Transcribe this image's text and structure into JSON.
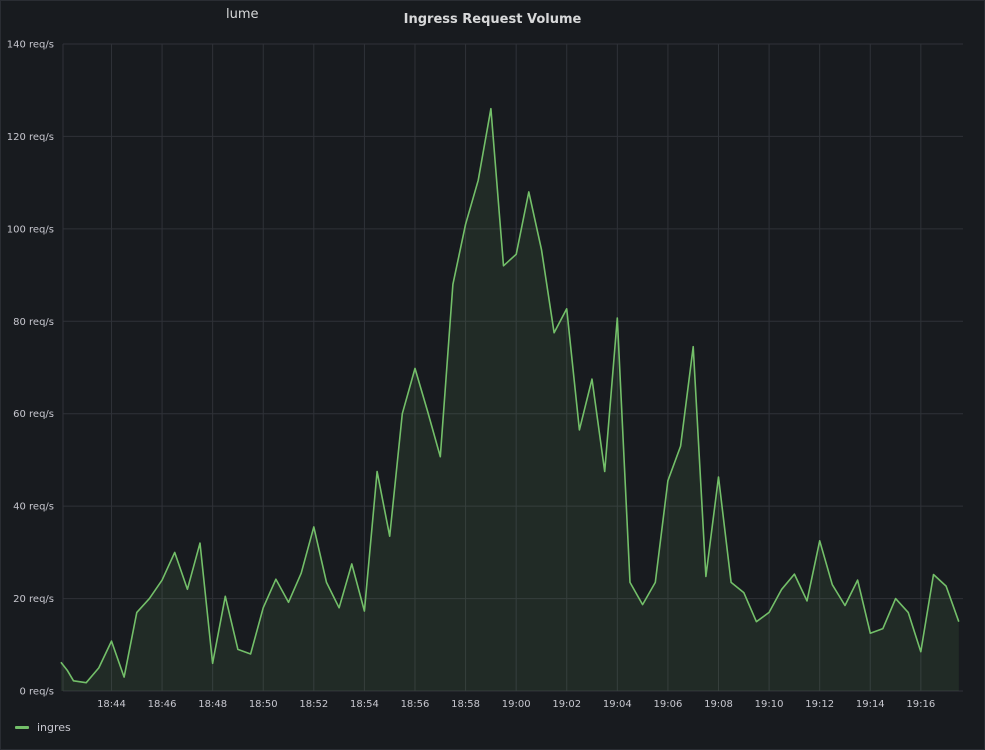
{
  "panel": {
    "ghost_title": "lume",
    "title": "Ingress Request Volume"
  },
  "chart_data": {
    "type": "area",
    "title": "Ingress Request Volume",
    "unit": "req/s",
    "ylim": [
      0,
      140
    ],
    "y_ticks": [
      "0 req/s",
      "20 req/s",
      "40 req/s",
      "60 req/s",
      "80 req/s",
      "100 req/s",
      "120 req/s",
      "140 req/s"
    ],
    "x_ticks": [
      "18:44",
      "18:46",
      "18:48",
      "18:50",
      "18:52",
      "18:54",
      "18:56",
      "18:58",
      "19:00",
      "19:02",
      "19:04",
      "19:06",
      "19:08",
      "19:10",
      "19:12",
      "19:14",
      "19:16"
    ],
    "xlim": [
      "18:42:05",
      "19:17:40"
    ],
    "grid": true,
    "legend_position": "bottom-left",
    "series": [
      {
        "name": "ingres",
        "color": "#73bf69",
        "points": [
          [
            "18:42:00",
            6.2
          ],
          [
            "18:42:15",
            4.5
          ],
          [
            "18:42:30",
            2.2
          ],
          [
            "18:43:00",
            1.8
          ],
          [
            "18:43:30",
            5.0
          ],
          [
            "18:44:00",
            10.8
          ],
          [
            "18:44:30",
            3.0
          ],
          [
            "18:45:00",
            17.0
          ],
          [
            "18:45:30",
            20.0
          ],
          [
            "18:46:00",
            24.0
          ],
          [
            "18:46:30",
            30.0
          ],
          [
            "18:47:00",
            22.0
          ],
          [
            "18:47:30",
            32.0
          ],
          [
            "18:48:00",
            6.0
          ],
          [
            "18:48:30",
            20.5
          ],
          [
            "18:49:00",
            9.0
          ],
          [
            "18:49:30",
            8.0
          ],
          [
            "18:50:00",
            18.0
          ],
          [
            "18:50:30",
            24.2
          ],
          [
            "18:51:00",
            19.2
          ],
          [
            "18:51:30",
            25.5
          ],
          [
            "18:52:00",
            35.5
          ],
          [
            "18:52:30",
            23.5
          ],
          [
            "18:53:00",
            18.0
          ],
          [
            "18:53:30",
            27.5
          ],
          [
            "18:54:00",
            17.3
          ],
          [
            "18:54:30",
            47.5
          ],
          [
            "18:55:00",
            33.5
          ],
          [
            "18:55:30",
            60.0
          ],
          [
            "18:56:00",
            69.8
          ],
          [
            "18:56:30",
            60.5
          ],
          [
            "18:57:00",
            50.7
          ],
          [
            "18:57:30",
            88.0
          ],
          [
            "18:58:00",
            101.0
          ],
          [
            "18:58:30",
            110.5
          ],
          [
            "18:59:00",
            126.0
          ],
          [
            "18:59:30",
            92.0
          ],
          [
            "19:00:00",
            94.5
          ],
          [
            "19:00:30",
            108.0
          ],
          [
            "19:01:00",
            95.5
          ],
          [
            "19:01:30",
            77.5
          ],
          [
            "19:02:00",
            82.7
          ],
          [
            "19:02:30",
            56.5
          ],
          [
            "19:03:00",
            67.5
          ],
          [
            "19:03:30",
            47.5
          ],
          [
            "19:04:00",
            80.7
          ],
          [
            "19:04:30",
            23.5
          ],
          [
            "19:05:00",
            18.7
          ],
          [
            "19:05:30",
            23.5
          ],
          [
            "19:06:00",
            45.5
          ],
          [
            "19:06:30",
            53.0
          ],
          [
            "19:07:00",
            74.5
          ],
          [
            "19:07:30",
            24.8
          ],
          [
            "19:08:00",
            46.3
          ],
          [
            "19:08:30",
            23.5
          ],
          [
            "19:09:00",
            21.3
          ],
          [
            "19:09:30",
            15.0
          ],
          [
            "19:10:00",
            17.0
          ],
          [
            "19:10:30",
            22.0
          ],
          [
            "19:11:00",
            25.3
          ],
          [
            "19:11:30",
            19.5
          ],
          [
            "19:12:00",
            32.5
          ],
          [
            "19:12:30",
            23.0
          ],
          [
            "19:13:00",
            18.5
          ],
          [
            "19:13:30",
            24.0
          ],
          [
            "19:14:00",
            12.5
          ],
          [
            "19:14:30",
            13.5
          ],
          [
            "19:15:00",
            20.0
          ],
          [
            "19:15:30",
            17.0
          ],
          [
            "19:16:00",
            8.5
          ],
          [
            "19:16:30",
            25.2
          ],
          [
            "19:17:00",
            22.7
          ],
          [
            "19:17:30",
            15.0
          ]
        ]
      }
    ]
  }
}
